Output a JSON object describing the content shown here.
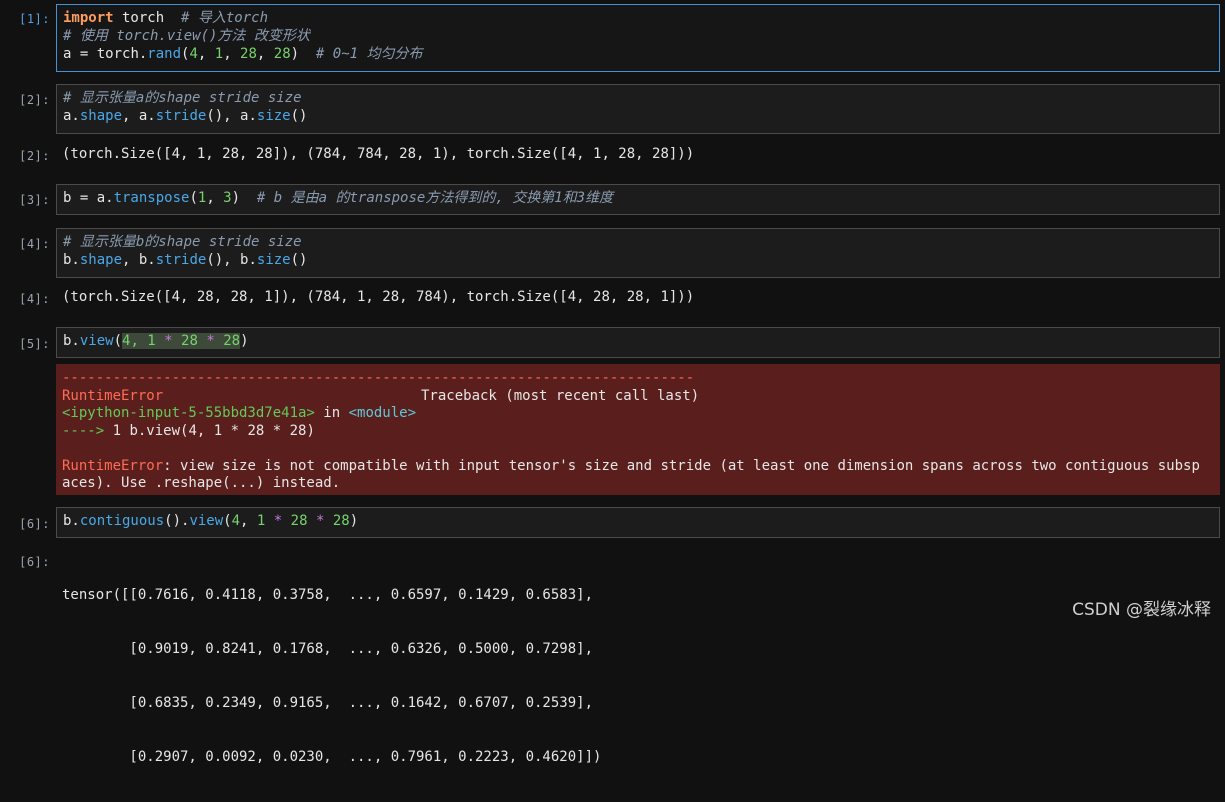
{
  "cells": [
    {
      "in_prompt": "[1]:",
      "lines": [
        [
          "import",
          " torch  ",
          "# 导入torch"
        ],
        [
          "# 使用 torch.view()方法 改变形状"
        ],
        [
          "a",
          " = torch.",
          "rand",
          "(",
          "4",
          ", ",
          "1",
          ", ",
          "28",
          ", ",
          "28",
          ")  ",
          "# 0~1 均匀分布"
        ]
      ]
    },
    {
      "in_prompt": "[2]:",
      "lines": [
        [
          "# 显示张量a的shape stride size"
        ],
        [
          "a.",
          "shape",
          ", a.",
          "stride",
          "(), a.",
          "size",
          "()"
        ]
      ],
      "out_prompt": "[2]:",
      "out": "(torch.Size([4, 1, 28, 28]), (784, 784, 28, 1), torch.Size([4, 1, 28, 28]))"
    },
    {
      "in_prompt": "[3]:",
      "lines": [
        [
          "b = a.",
          "transpose",
          "(",
          "1",
          ", ",
          "3",
          ")  ",
          "# b 是由a 的transpose方法得到的, 交换第1和3维度"
        ]
      ]
    },
    {
      "in_prompt": "[4]:",
      "lines": [
        [
          "# 显示张量b的shape stride size"
        ],
        [
          "b.",
          "shape",
          ", b.",
          "stride",
          "(), b.",
          "size",
          "()"
        ]
      ],
      "out_prompt": "[4]:",
      "out": "(torch.Size([4, 28, 28, 1]), (784, 1, 28, 784), torch.Size([4, 28, 28, 1]))"
    },
    {
      "in_prompt": "[5]:",
      "lines": [
        [
          "b.",
          "view",
          "(",
          "4, 1 ",
          "*",
          " 28 ",
          "*",
          " 28",
          ")"
        ]
      ],
      "error": {
        "rule": "---------------------------------------------------------------------------",
        "name": "RuntimeError",
        "traceback_label": "Traceback (most recent call last)",
        "input_ref": "<ipython-input-5-55bbd3d7e41a>",
        "in_word": " in ",
        "module": "<module>",
        "arrow": "---->",
        "arrow_line": " 1 b.view(4, 1 * 28 * 28)",
        "message_name": "RuntimeError",
        "message_1": ": view size is not compatible with input tensor's size and stride (at least one dimension spans across two contiguous subsp",
        "message_2": "aces). Use .reshape(...) instead."
      }
    },
    {
      "in_prompt": "[6]:",
      "lines": [
        [
          "b.",
          "contiguous",
          "().",
          "view",
          "(",
          "4",
          ", ",
          "1",
          " ",
          "*",
          " ",
          "28",
          " ",
          "*",
          " ",
          "28",
          ")"
        ]
      ],
      "out_prompt": "[6]:",
      "out_lines": [
        "tensor([[0.7616, 0.4118, 0.3758,  ..., 0.6597, 0.1429, 0.6583],",
        "        [0.9019, 0.8241, 0.1768,  ..., 0.6326, 0.5000, 0.7298],",
        "        [0.6835, 0.2349, 0.9165,  ..., 0.1642, 0.6707, 0.2539],",
        "        [0.2907, 0.0092, 0.0230,  ..., 0.7961, 0.2223, 0.4620]])"
      ]
    }
  ],
  "watermark": "CSDN @裂缘冰释"
}
